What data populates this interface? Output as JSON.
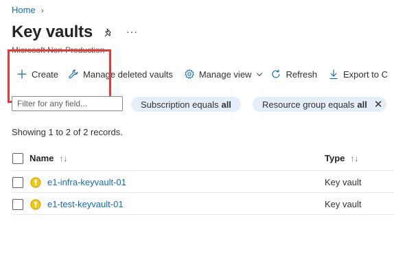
{
  "breadcrumb": {
    "home_label": "Home"
  },
  "page": {
    "title": "Key vaults",
    "subtitle": "Microsoft Non-Production"
  },
  "toolbar": {
    "create_label": "Create",
    "manage_deleted_label": "Manage deleted vaults",
    "manage_view_label": "Manage view",
    "refresh_label": "Refresh",
    "export_label": "Export to C"
  },
  "filters": {
    "search_placeholder": "Filter for any field...",
    "subscription_prefix": "Subscription equals",
    "subscription_value": "all",
    "resource_group_prefix": "Resource group equals",
    "resource_group_value": "all"
  },
  "records_text": "Showing 1 to 2 of 2 records.",
  "table": {
    "columns": [
      "Name",
      "Type"
    ],
    "rows": [
      {
        "name": "e1-infra-keyvault-01",
        "type": "Key vault"
      },
      {
        "name": "e1-test-keyvault-01",
        "type": "Key vault"
      }
    ]
  },
  "colors": {
    "accent": "#0f6cbd",
    "highlight": "#e53935",
    "pill": "#e5effa",
    "key_icon": "#f2c811"
  },
  "icons": [
    "chevron-right-icon",
    "pin-icon",
    "more-icon",
    "plus-icon",
    "wrench-icon",
    "gear-icon",
    "chevron-down-icon",
    "refresh-icon",
    "download-icon",
    "close-icon",
    "sort-icon",
    "key-vault-icon"
  ]
}
